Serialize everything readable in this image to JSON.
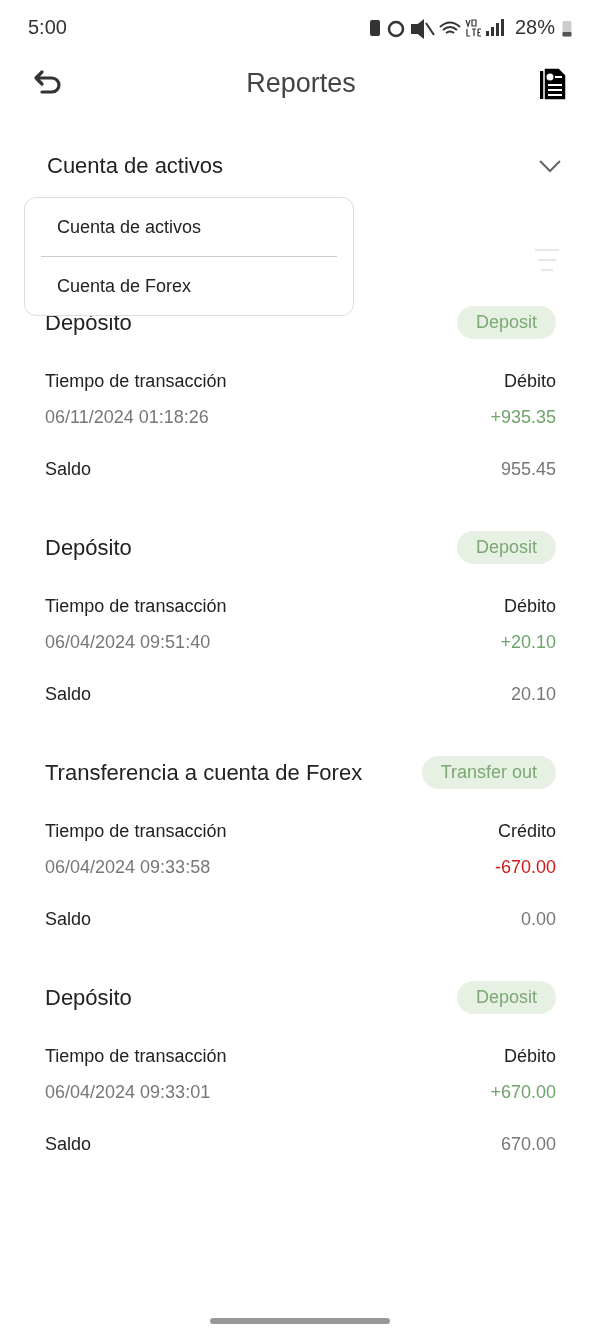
{
  "status_bar": {
    "time": "5:00",
    "battery": "28%"
  },
  "header": {
    "title": "Reportes"
  },
  "account_selector": {
    "value": "Cuenta de activos",
    "expanded": true
  },
  "dropdown": {
    "options": [
      {
        "label": "Cuenta de activos"
      },
      {
        "label": "Cuenta de Forex"
      }
    ]
  },
  "transactions": [
    {
      "title": "Depósito",
      "badge": "Deposit",
      "time_label": "Tiempo de transacción",
      "time": "06/11/2024 01:18:26",
      "type_label": "Débito",
      "amount": "+935.35",
      "kind": "in",
      "balance_label": "Saldo",
      "balance": "955.45"
    },
    {
      "title": "Depósito",
      "badge": "Deposit",
      "time_label": "Tiempo de transacción",
      "time": "06/04/2024 09:51:40",
      "type_label": "Débito",
      "amount": "+20.10",
      "kind": "in",
      "balance_label": "Saldo",
      "balance": "20.10"
    },
    {
      "title": "Transferencia a cuenta de Forex",
      "badge": "Transfer out",
      "time_label": "Tiempo de transacción",
      "time": "06/04/2024 09:33:58",
      "type_label": "Crédito",
      "amount": "-670.00",
      "kind": "out",
      "balance_label": "Saldo",
      "balance": "0.00"
    },
    {
      "title": "Depósito",
      "badge": "Deposit",
      "time_label": "Tiempo de transacción",
      "time": "06/04/2024 09:33:01",
      "type_label": "Débito",
      "amount": "+670.00",
      "kind": "in",
      "balance_label": "Saldo",
      "balance": "670.00"
    }
  ]
}
